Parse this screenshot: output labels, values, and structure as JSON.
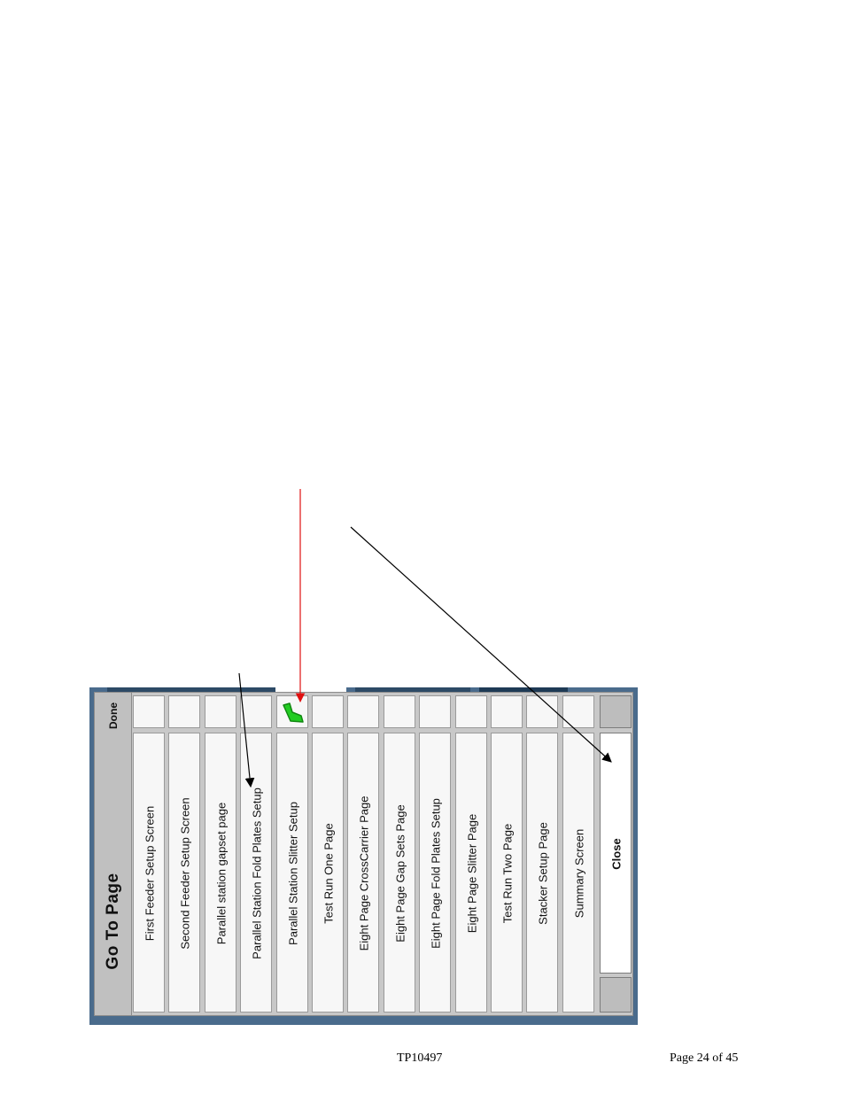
{
  "dialog": {
    "title": "Go To Page",
    "done_label": "Done",
    "items": [
      {
        "label": "First Feeder Setup Screen",
        "checked": false
      },
      {
        "label": "Second Feeder Setup Screen",
        "checked": false
      },
      {
        "label": "Parallel station gapset page",
        "checked": false
      },
      {
        "label": "Parallel Station Fold Plates Setup",
        "checked": false
      },
      {
        "label": "Parallel Station Slitter Setup",
        "checked": true
      },
      {
        "label": "Test Run One Page",
        "checked": false
      },
      {
        "label": "Eight Page CrossCarrier Page",
        "checked": false
      },
      {
        "label": "Eight Page Gap Sets Page",
        "checked": false
      },
      {
        "label": "Eight Page Fold Plates Setup",
        "checked": false
      },
      {
        "label": "Eight Page Slitter Page",
        "checked": false
      },
      {
        "label": "Test Run Two Page",
        "checked": false
      },
      {
        "label": "Stacker Setup Page",
        "checked": false
      },
      {
        "label": "Summary Screen",
        "checked": false
      }
    ],
    "close_label": "Close"
  },
  "icons": {
    "checkmark": "checkmark-icon"
  },
  "colors": {
    "window_bg": "#4a6b8c",
    "panel": "#c8c8c8",
    "check_green": "#22cc22",
    "arrow_red": "#e01010",
    "arrow_black": "#000000"
  },
  "footer": {
    "doc_id": "TP10497",
    "page": "Page 24 of 45"
  }
}
